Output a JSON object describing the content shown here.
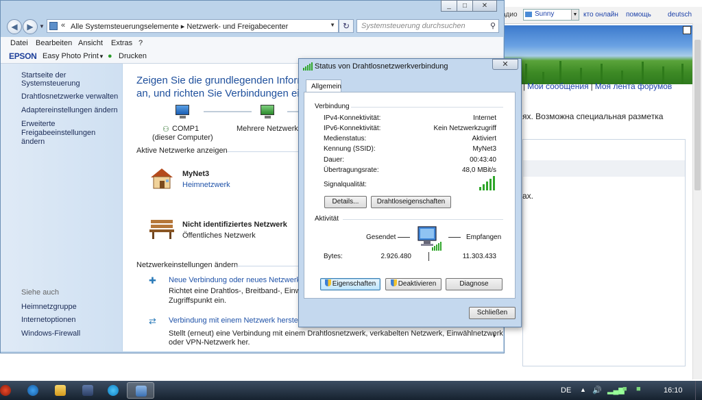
{
  "browser": {
    "tag": "адио",
    "select_value": "Sunny",
    "links": [
      "кто онлайн",
      "помощь",
      "deutsch"
    ],
    "forum_links": [
      "Мои сообщения",
      "Моя лента форумов"
    ],
    "text1": "ях. Возможна специальная разметка",
    "text2": "ax."
  },
  "window": {
    "controls": [
      "_",
      "□",
      "✕"
    ],
    "address": "Alle Systemsteuerungselemente  ▸  Netzwerk- und Freigabecenter",
    "search_placeholder": "Systemsteuerung durchsuchen",
    "menu": [
      "Datei",
      "Bearbeiten",
      "Ansicht",
      "Extras",
      "?"
    ],
    "epson": {
      "logo": "EPSON",
      "easy_photo_print": "Easy Photo Print",
      "print": "Drucken"
    }
  },
  "sidebar": {
    "home": "Startseite der Systemsteuerung",
    "items": [
      "Drahtlosnetzwerke verwalten",
      "Adaptereinstellungen ändern",
      "Erweiterte Freigabeeinstellungen ändern"
    ],
    "see_also_title": "Siehe auch",
    "see_also": [
      "Heimnetzgruppe",
      "Internetoptionen",
      "Windows-Firewall"
    ]
  },
  "content": {
    "heading": "Zeigen Sie die grundlegenden Informationen zum Netzwerk an, und richten Sie Verbindungen ein.",
    "comp_name": "COMP1",
    "comp_sub": "(dieser Computer)",
    "multiple_networks": "Mehrere Netzwerke",
    "active_networks_title": "Aktive Netzwerke anzeigen",
    "network1_name": "MyNet3",
    "network1_type": "Heimnetzwerk",
    "network2_name": "Nicht identifiziertes Netzwerk",
    "network2_type": "Öffentliches Netzwerk",
    "settings_title": "Netzwerkeinstellungen ändern",
    "task1_link": "Neue Verbindung oder neues Netzwerk ei",
    "task1_desc1": "Richtet eine Drahtlos-, Breitband-, Einwä",
    "task1_desc2": "Zugriffspunkt ein.",
    "task2_link": "Verbindung mit einem Netzwerk herstelle",
    "task2_desc1": "Stellt (erneut) eine Verbindung mit einem Drahtlosnetzwerk, verkabelten Netzwerk, Einwählnetzwerk",
    "task2_desc2": "oder VPN-Netzwerk her."
  },
  "dialog": {
    "title": "Status von Drahtlosnetzwerkverbindung",
    "close_x": "✕",
    "tab": "Allgemein",
    "connection_group": "Verbindung",
    "rows": [
      {
        "label": "IPv4-Konnektivität:",
        "value": "Internet"
      },
      {
        "label": "IPv6-Konnektivität:",
        "value": "Kein Netzwerkzugriff"
      },
      {
        "label": "Medienstatus:",
        "value": "Aktiviert"
      },
      {
        "label": "Kennung (SSID):",
        "value": "MyNet3"
      },
      {
        "label": "Dauer:",
        "value": "00:43:40"
      },
      {
        "label": "Übertragungsrate:",
        "value": "48,0 MBit/s"
      }
    ],
    "signal_label": "Signalqualität:",
    "signal_bars": 5,
    "details_btn": "Details...",
    "wireless_props_btn": "Drahtloseigenschaften",
    "activity_group": "Aktivität",
    "sent_label": "Gesendet",
    "received_label": "Empfangen",
    "bytes_label": "Bytes:",
    "bytes_sent": "2.926.480",
    "bytes_received": "11.303.433",
    "properties_btn": "Eigenschaften",
    "deactivate_btn": "Deaktivieren",
    "diagnose_btn": "Diagnose",
    "close_btn": "Schließen"
  },
  "taskbar": {
    "lang": "DE",
    "clock": "16:10"
  },
  "colors": {
    "accent": "#1e4f9c",
    "link": "#1f52a8",
    "signal": "#2fa62a"
  }
}
